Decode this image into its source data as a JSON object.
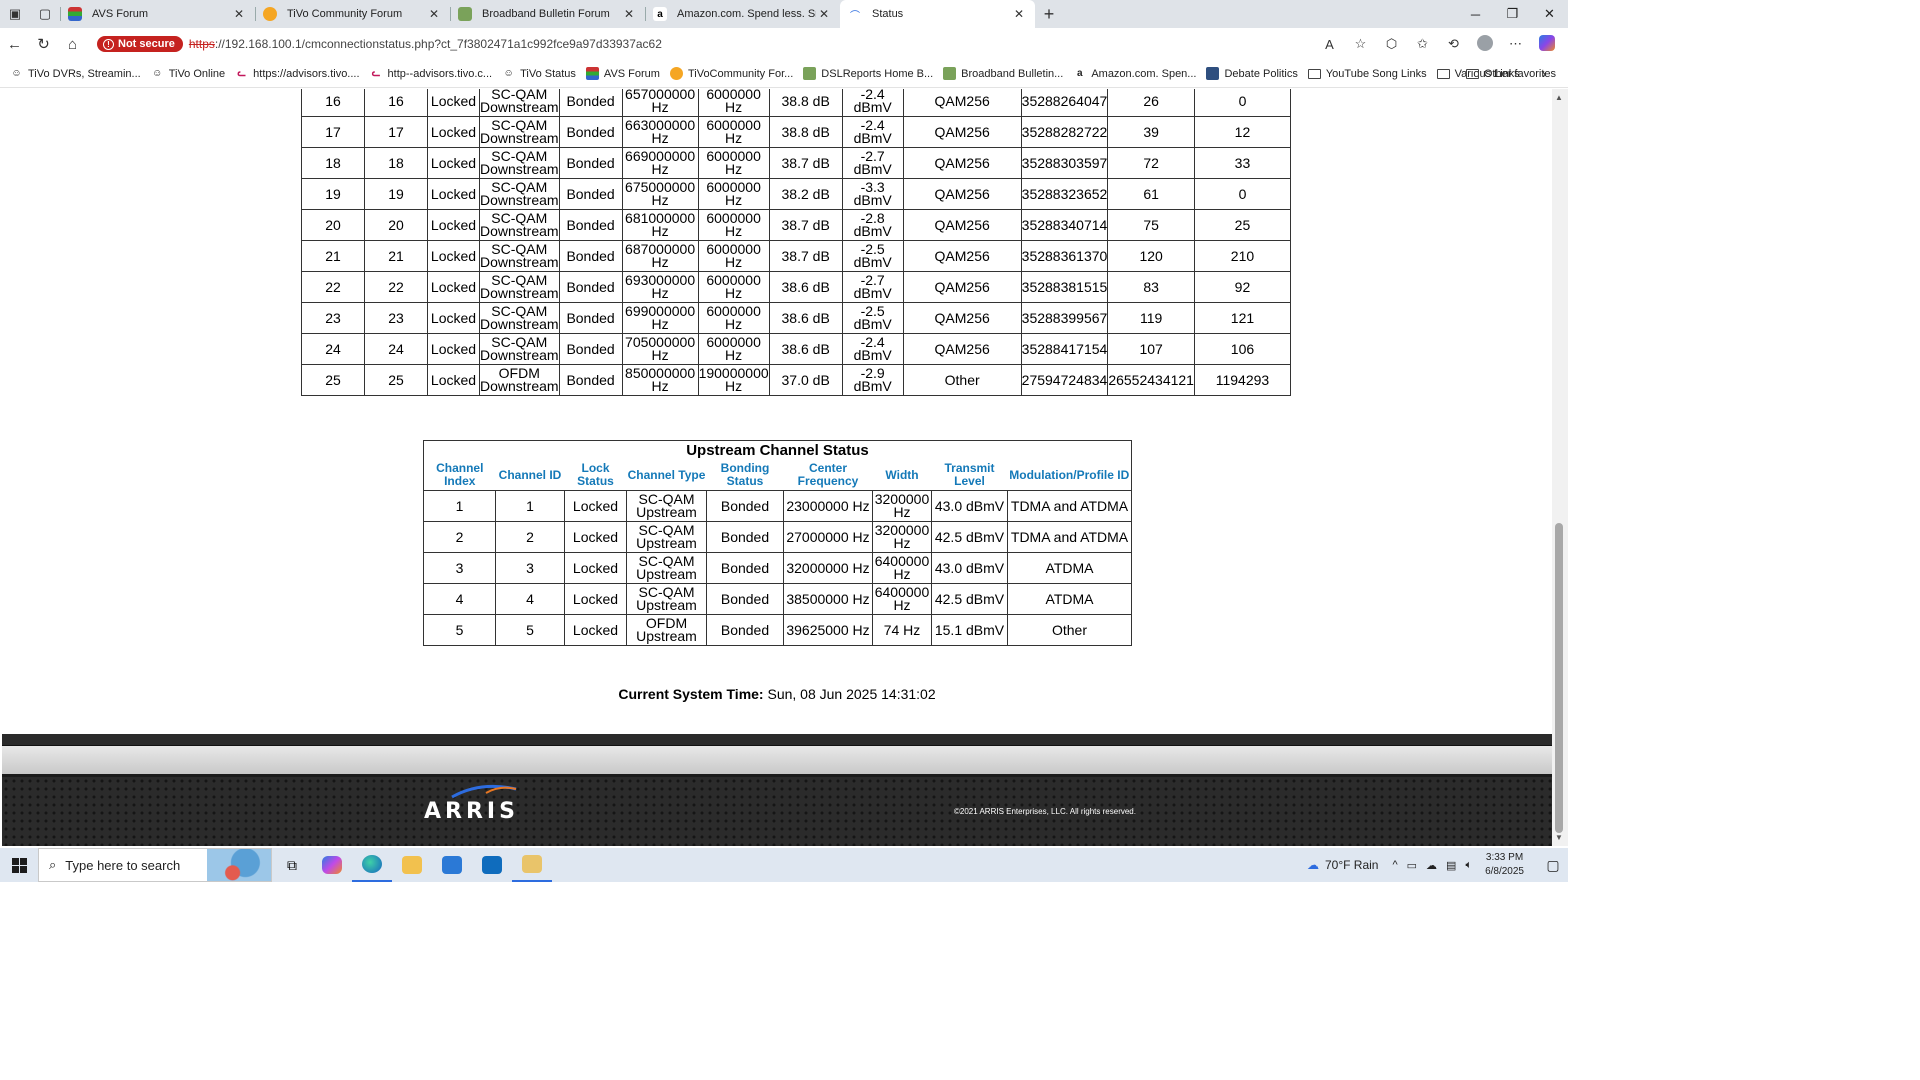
{
  "browser": {
    "tabs": [
      {
        "title": "AVS Forum",
        "icon": "avs-forum-icon",
        "active": false
      },
      {
        "title": "TiVo Community Forum",
        "icon": "tivo-community-icon",
        "active": false
      },
      {
        "title": "Broadband Bulletin Forum",
        "icon": "broadband-bulletin-icon",
        "active": false
      },
      {
        "title": "Amazon.com. Spend less. Smile m",
        "icon": "amazon-icon",
        "active": false
      },
      {
        "title": "Status",
        "icon": "arris-icon",
        "active": true
      }
    ],
    "security_label": "Not secure",
    "url_scheme": "https",
    "url_rest": "://192.168.100.1/cmconnectionstatus.php?ct_7f3802471a1c992fce9a97d33937ac62",
    "bookmarks": [
      {
        "label": "TiVo DVRs, Streamin...",
        "icon": "tivo-icon"
      },
      {
        "label": "TiVo Online",
        "icon": "tivo-icon"
      },
      {
        "label": "https://advisors.tivo....",
        "icon": "advisors-icon"
      },
      {
        "label": "http--advisors.tivo.c...",
        "icon": "advisors-icon"
      },
      {
        "label": "TiVo Status",
        "icon": "tivo-icon"
      },
      {
        "label": "AVS Forum",
        "icon": "avs-forum-icon"
      },
      {
        "label": "TiVoCommunity For...",
        "icon": "tivo-community-icon"
      },
      {
        "label": "DSLReports Home B...",
        "icon": "dslreports-icon"
      },
      {
        "label": "Broadband Bulletin...",
        "icon": "broadband-bulletin-icon"
      },
      {
        "label": "Amazon.com. Spen...",
        "icon": "amazon-icon"
      },
      {
        "label": "Debate Politics",
        "icon": "debate-politics-icon"
      },
      {
        "label": "YouTube Song Links",
        "icon": "folder-icon"
      },
      {
        "label": "Various Links",
        "icon": "folder-icon"
      }
    ],
    "other_favorites": "Other favorites"
  },
  "downstream": {
    "rows": [
      [
        "16",
        "16",
        "Locked",
        "SC-QAM Downstream",
        "Bonded",
        "657000000 Hz",
        "6000000 Hz",
        "38.8 dB",
        "-2.4 dBmV",
        "QAM256",
        "35288264047",
        "26",
        "0"
      ],
      [
        "17",
        "17",
        "Locked",
        "SC-QAM Downstream",
        "Bonded",
        "663000000 Hz",
        "6000000 Hz",
        "38.8 dB",
        "-2.4 dBmV",
        "QAM256",
        "35288282722",
        "39",
        "12"
      ],
      [
        "18",
        "18",
        "Locked",
        "SC-QAM Downstream",
        "Bonded",
        "669000000 Hz",
        "6000000 Hz",
        "38.7 dB",
        "-2.7 dBmV",
        "QAM256",
        "35288303597",
        "72",
        "33"
      ],
      [
        "19",
        "19",
        "Locked",
        "SC-QAM Downstream",
        "Bonded",
        "675000000 Hz",
        "6000000 Hz",
        "38.2 dB",
        "-3.3 dBmV",
        "QAM256",
        "35288323652",
        "61",
        "0"
      ],
      [
        "20",
        "20",
        "Locked",
        "SC-QAM Downstream",
        "Bonded",
        "681000000 Hz",
        "6000000 Hz",
        "38.7 dB",
        "-2.8 dBmV",
        "QAM256",
        "35288340714",
        "75",
        "25"
      ],
      [
        "21",
        "21",
        "Locked",
        "SC-QAM Downstream",
        "Bonded",
        "687000000 Hz",
        "6000000 Hz",
        "38.7 dB",
        "-2.5 dBmV",
        "QAM256",
        "35288361370",
        "120",
        "210"
      ],
      [
        "22",
        "22",
        "Locked",
        "SC-QAM Downstream",
        "Bonded",
        "693000000 Hz",
        "6000000 Hz",
        "38.6 dB",
        "-2.7 dBmV",
        "QAM256",
        "35288381515",
        "83",
        "92"
      ],
      [
        "23",
        "23",
        "Locked",
        "SC-QAM Downstream",
        "Bonded",
        "699000000 Hz",
        "6000000 Hz",
        "38.6 dB",
        "-2.5 dBmV",
        "QAM256",
        "35288399567",
        "119",
        "121"
      ],
      [
        "24",
        "24",
        "Locked",
        "SC-QAM Downstream",
        "Bonded",
        "705000000 Hz",
        "6000000 Hz",
        "38.6 dB",
        "-2.4 dBmV",
        "QAM256",
        "35288417154",
        "107",
        "106"
      ],
      [
        "25",
        "25",
        "Locked",
        "OFDM Downstream",
        "Bonded",
        "850000000 Hz",
        "190000000 Hz",
        "37.0 dB",
        "-2.9 dBmV",
        "Other",
        "27594724834",
        "26552434121",
        "1194293"
      ]
    ]
  },
  "upstream": {
    "title": "Upstream Channel Status",
    "headers": [
      "Channel Index",
      "Channel ID",
      "Lock Status",
      "Channel Type",
      "Bonding Status",
      "Center Frequency",
      "Width",
      "Transmit Level",
      "Modulation/Profile ID"
    ],
    "rows": [
      [
        "1",
        "1",
        "Locked",
        "SC-QAM Upstream",
        "Bonded",
        "23000000 Hz",
        "3200000 Hz",
        "43.0 dBmV",
        "TDMA and ATDMA"
      ],
      [
        "2",
        "2",
        "Locked",
        "SC-QAM Upstream",
        "Bonded",
        "27000000 Hz",
        "3200000 Hz",
        "42.5 dBmV",
        "TDMA and ATDMA"
      ],
      [
        "3",
        "3",
        "Locked",
        "SC-QAM Upstream",
        "Bonded",
        "32000000 Hz",
        "6400000 Hz",
        "43.0 dBmV",
        "ATDMA"
      ],
      [
        "4",
        "4",
        "Locked",
        "SC-QAM Upstream",
        "Bonded",
        "38500000 Hz",
        "6400000 Hz",
        "42.5 dBmV",
        "ATDMA"
      ],
      [
        "5",
        "5",
        "Locked",
        "OFDM Upstream",
        "Bonded",
        "39625000 Hz",
        "74 Hz",
        "15.1 dBmV",
        "Other"
      ]
    ]
  },
  "system_time": {
    "label": "Current System Time:",
    "value": "Sun, 08 Jun 2025 14:31:02"
  },
  "footer": {
    "logo": "ARRIS",
    "copyright": "©2021 ARRIS Enterprises, LLC. All rights reserved."
  },
  "taskbar": {
    "search_placeholder": "Type here to search",
    "weather": "70°F  Rain",
    "time": "3:33 PM",
    "date": "6/8/2025",
    "apps": [
      "task-view-icon",
      "copilot-icon",
      "edge-icon",
      "file-explorer-icon",
      "store-icon",
      "outlook-icon",
      "folder-app-icon"
    ]
  },
  "colors": {
    "header_blue": "#1479b8",
    "not_secure_red": "#c5221f"
  }
}
